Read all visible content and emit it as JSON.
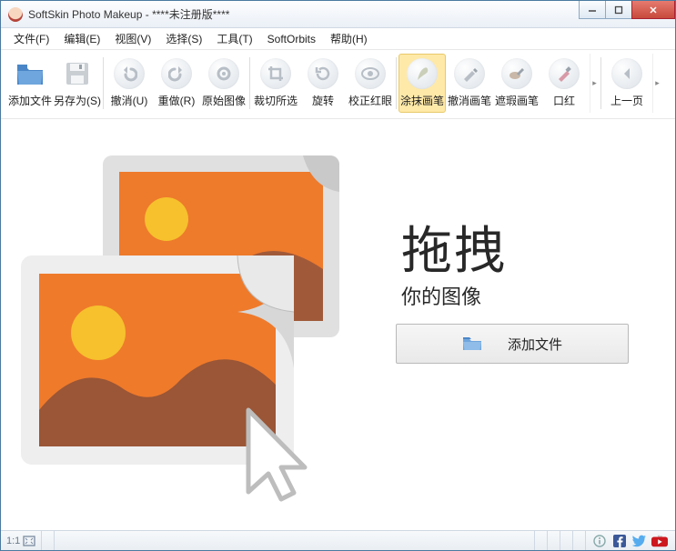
{
  "window": {
    "title": "SoftSkin Photo Makeup - ****未注册版****"
  },
  "menubar": [
    {
      "label": "文件(F)"
    },
    {
      "label": "编辑(E)"
    },
    {
      "label": "视图(V)"
    },
    {
      "label": "选择(S)"
    },
    {
      "label": "工具(T)"
    },
    {
      "label": "SoftOrbits"
    },
    {
      "label": "帮助(H)"
    }
  ],
  "toolbar": [
    {
      "label": "添加文件",
      "icon": "add-file"
    },
    {
      "label": "另存为(S)",
      "icon": "save"
    },
    {
      "label": "撤消(U)",
      "icon": "undo"
    },
    {
      "label": "重做(R)",
      "icon": "redo"
    },
    {
      "label": "原始图像",
      "icon": "original"
    },
    {
      "label": "裁切所选",
      "icon": "crop"
    },
    {
      "label": "旋转",
      "icon": "rotate"
    },
    {
      "label": "校正红眼",
      "icon": "redeye"
    },
    {
      "label": "涂抹画笔",
      "icon": "smudge",
      "selected": true
    },
    {
      "label": "撤消画笔",
      "icon": "undo-brush"
    },
    {
      "label": "遮瑕画笔",
      "icon": "concealer"
    },
    {
      "label": "口红",
      "icon": "lipstick"
    },
    {
      "label": "上一页",
      "icon": "prev-page"
    }
  ],
  "content": {
    "drag_title": "拖拽",
    "drag_sub": "你的图像",
    "add_button": "添加文件"
  },
  "status": {
    "zoom": "1:1"
  }
}
